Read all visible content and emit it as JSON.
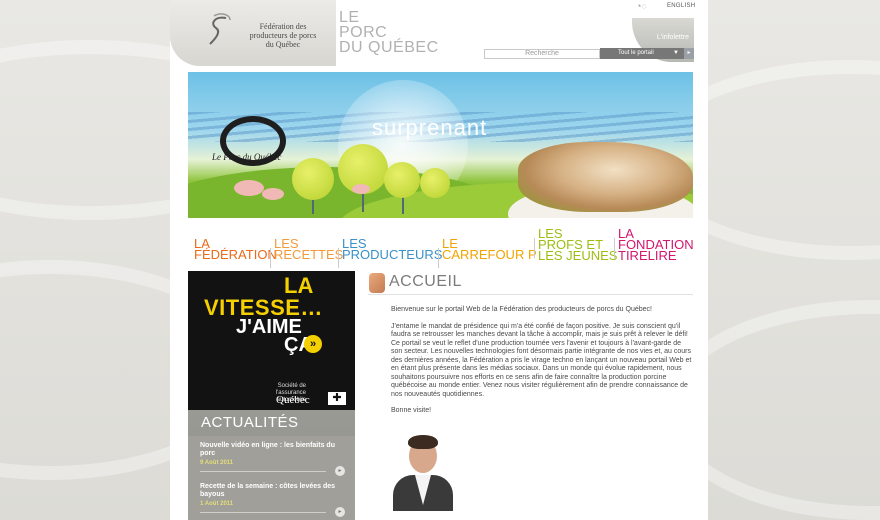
{
  "header": {
    "logo_lines": [
      "Fédération des",
      "producteurs de porcs",
      "du Québec"
    ],
    "site_title_lines": [
      "LE",
      "PORC",
      "DU QUÉBEC"
    ],
    "language_link": "ENGLISH",
    "search_placeholder": "Recherche",
    "search_scope": "Tout le portail",
    "infolettre": "L'infolettre"
  },
  "banner": {
    "brand": "Le Porc du Québec",
    "slogan": "surprenant"
  },
  "nav": {
    "items": [
      {
        "line1": "LA",
        "line2": "FÉDÉRATION",
        "color": "#e86a1a"
      },
      {
        "line1": "LES",
        "line2": "RECETTES",
        "color": "#f29a3a"
      },
      {
        "line1": "LES",
        "line2": "PRODUCTEURS",
        "color": "#3a90c8"
      },
      {
        "line1": "LE",
        "line2": "CARREFOUR P",
        "color": "#f0a400"
      },
      {
        "line1": "LES",
        "line2": "PROFS ET",
        "line3": "LES JEUNES",
        "color": "#9dbd12"
      },
      {
        "line1": "LA",
        "line2": "FONDATION",
        "line3": "TIRELIRE",
        "color": "#d3166e"
      }
    ]
  },
  "ad": {
    "line1": "LA",
    "line2": "VITESSE…",
    "line3": "J'AIME",
    "line4": "ÇA",
    "org_line1": "Société de l'assurance",
    "org_line2": "automobile",
    "org_name": "Québec"
  },
  "news": {
    "title": "ACTUALITÉS",
    "items": [
      {
        "title": "Nouvelle vidéo en ligne : les bienfaits du porc",
        "date": "9 Août 2011"
      },
      {
        "title": "Recette de la semaine : côtes levées des bayous",
        "date": "1 Août 2011"
      }
    ]
  },
  "main": {
    "title": "ACCUEIL",
    "paragraphs": [
      "Bienvenue sur le portail Web de la Fédération des producteurs de porcs du Québec!",
      "J'entame le mandat de présidence qui m'a été confié de façon positive. Je suis conscient qu'il faudra se retrousser les manches devant la tâche à accomplir, mais je suis prêt à relever le défi! Ce portail se veut le reflet d'une production tournée vers l'avenir et toujours à l'avant-garde de son secteur. Les nouvelles technologies font désormais partie intégrante de nos vies et, au cours des dernières années, la Fédération a pris le virage techno en lançant un nouveau portail Web et en étant plus présente dans les médias sociaux. Dans un monde qui évolue rapidement, nous souhaitons poursuivre nos efforts en ce sens afin de faire connaître la production porcine québécoise au monde entier. Venez nous visiter régulièrement afin de prendre connaissance de nos nouveautés quotidiennes.",
      "Bonne visite!"
    ]
  }
}
